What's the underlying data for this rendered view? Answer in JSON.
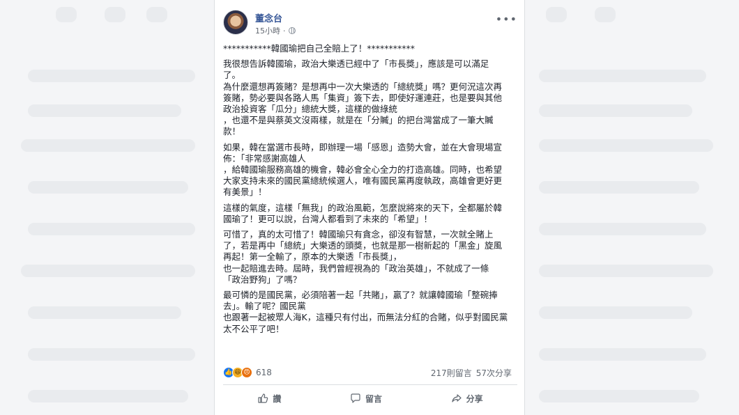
{
  "post": {
    "author": "董念台",
    "time": "15小時",
    "body": [
      [
        "***********韓國瑜把自己全賠上了！***********"
      ],
      [
        "我很想告訴韓國瑜，政治大樂透已經中了「市長獎」，應該是可以滿足",
        "了。",
        "為什麼還想再簽賭？是想再中一次大樂透的「總統獎」嗎？更何況這次再",
        "簽賭，勢必要與各路人馬「集資」簽下去，即使好運連莊，也是要與其他",
        "政治投資客「瓜分」總統大獎，這樣的做綠統",
        "，也還不是與蔡英文沒兩樣，就是在「分贓」的把台灣當成了一筆大贓",
        "款！"
      ],
      [
        "如果，韓在當選市長時，即辦理一場「感恩」造勢大會，並在大會現場宣",
        "佈：「非常感謝高雄人",
        "，給韓國瑜服務高雄的機會，韓必會全心全力的打造高雄。同時，也希望",
        "大家支持未來的國民黨總統候選人，唯有國民黨再度執政，高雄會更好更",
        "有美景」！"
      ],
      [
        "這樣的氣度，這樣「無我」的政治風範，怎麼說將來的天下，全都屬於韓",
        "國瑜了！更可以說，台灣人都看到了未來的「希望」！"
      ],
      [
        "可惜了，真的太可惜了！韓國瑜只有貪念，卻沒有智慧，一次就全賭上",
        "了，若是再中「總統」大樂透的頭獎，也就是那一樹新起的「黑金」旋風",
        "再起！第一全輸了，原本的大樂透「市長獎」，",
        "也一起賠進去時。屆時，我們曾經視為的「政治英雄」，不就成了一條",
        "「政治野狗」了嗎？"
      ],
      [
        "最可憐的是國民黨，必須陪著一起「共賭」，贏了？就讓韓國瑜「整碗捧",
        "去」。輸了呢？國民黨",
        "也跟著一起被眾人海K，這種只有付出，而無法分紅的合賭，似乎對國民黨",
        "太不公平了吧！"
      ]
    ],
    "reactions": {
      "icons": [
        "like-icon",
        "haha-icon",
        "angry-icon"
      ],
      "count": "618"
    },
    "comments": "217則留言",
    "shares": "57次分享",
    "actions": {
      "like": "讚",
      "comment": "留言",
      "share": "分享"
    }
  },
  "colors": {
    "author": "#385898",
    "text": "#1d2129",
    "muted": "#606770",
    "like": "#1877f2"
  }
}
